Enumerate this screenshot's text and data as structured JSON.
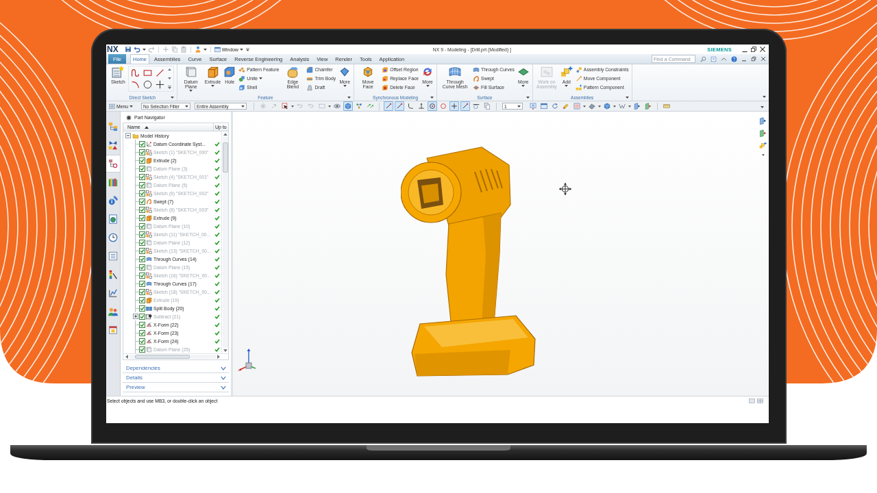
{
  "title_bar": {
    "logo": "NX",
    "window_menu": "Window",
    "title": "NX 9 - Modeling - [Drill.prt (Modified) ]",
    "brand": "SIEMENS"
  },
  "ribbon": {
    "file_menu": "File",
    "tabs": [
      {
        "label": "Home",
        "selected": true
      },
      {
        "label": "Assemblies",
        "selected": false
      },
      {
        "label": "Curve",
        "selected": false
      },
      {
        "label": "Surface",
        "selected": false
      },
      {
        "label": "Reverse Engineering",
        "selected": false
      },
      {
        "label": "Analysis",
        "selected": false
      },
      {
        "label": "View",
        "selected": false
      },
      {
        "label": "Render",
        "selected": false
      },
      {
        "label": "Tools",
        "selected": false
      },
      {
        "label": "Application",
        "selected": false
      }
    ],
    "search": {
      "placeholder": "Find a Command"
    },
    "groups": [
      {
        "label": "Direct Sketch",
        "items": [
          {
            "kind": "large",
            "label": "Sketch",
            "menu": false,
            "disabled": false
          },
          {
            "kind": "palette"
          }
        ]
      },
      {
        "label": "Feature",
        "items": [
          {
            "kind": "large",
            "label": "Datum Plane",
            "menu": true,
            "disabled": false
          },
          {
            "kind": "large",
            "label": "Extrude",
            "menu": true,
            "disabled": false
          },
          {
            "kind": "large",
            "label": "Hole",
            "menu": false,
            "disabled": false
          },
          {
            "kind": "stack",
            "entries": [
              {
                "label": "Pattern Feature",
                "menu": false
              },
              {
                "label": "Unite",
                "menu": true
              },
              {
                "label": "Shell",
                "menu": false
              }
            ]
          },
          {
            "kind": "large",
            "label": "Edge Blend",
            "menu": false,
            "disabled": false
          },
          {
            "kind": "stack",
            "entries": [
              {
                "label": "Chamfer",
                "menu": false
              },
              {
                "label": "Trim Body",
                "menu": false
              },
              {
                "label": "Draft",
                "menu": false
              }
            ]
          },
          {
            "kind": "large",
            "label": "More",
            "menu": true,
            "disabled": false
          }
        ]
      },
      {
        "label": "Synchronous Modeling",
        "items": [
          {
            "kind": "large",
            "label": "Move Face",
            "menu": false,
            "disabled": false
          },
          {
            "kind": "stack",
            "entries": [
              {
                "label": "Offset Region",
                "menu": false
              },
              {
                "label": "Replace Face",
                "menu": false
              },
              {
                "label": "Delete Face",
                "menu": false
              }
            ]
          },
          {
            "kind": "large",
            "label": "More",
            "menu": true,
            "disabled": false
          }
        ]
      },
      {
        "label": "Surface",
        "items": [
          {
            "kind": "large",
            "label": "Through Curve Mesh",
            "menu": false,
            "disabled": false
          },
          {
            "kind": "stack",
            "entries": [
              {
                "label": "Through Curves",
                "menu": false
              },
              {
                "label": "Swept",
                "menu": false
              },
              {
                "label": "Fill Surface",
                "menu": false
              }
            ]
          },
          {
            "kind": "large",
            "label": "More",
            "menu": true,
            "disabled": false
          }
        ]
      },
      {
        "label": "Assemblies",
        "items": [
          {
            "kind": "large",
            "label": "Work on Assembly",
            "menu": false,
            "disabled": true
          },
          {
            "kind": "large",
            "label": "Add",
            "menu": true,
            "disabled": false
          },
          {
            "kind": "stack",
            "entries": [
              {
                "label": "Assembly Constraints",
                "menu": false
              },
              {
                "label": "Move Component",
                "menu": false
              },
              {
                "label": "Pattern Component",
                "menu": false
              }
            ]
          }
        ]
      }
    ]
  },
  "toolbar": {
    "menu": "Menu",
    "filters": [
      "No Selection Filter",
      "Entire Assembly"
    ],
    "selection_tools": [
      {
        "selected": false
      },
      {
        "selected": false
      },
      {
        "selected": false
      },
      {
        "selected": false
      },
      {
        "selected": false
      },
      {
        "selected": false
      },
      {
        "selected": false
      },
      {
        "selected": true
      },
      {
        "selected": false
      },
      {
        "selected": false
      }
    ],
    "snap_tools": [
      {
        "selected": true
      },
      {
        "selected": true
      },
      {
        "selected": false
      },
      {
        "selected": false
      },
      {
        "selected": true
      },
      {
        "selected": false
      },
      {
        "selected": true
      },
      {
        "selected": true
      },
      {
        "selected": false
      },
      {
        "selected": false
      }
    ],
    "layer": "1",
    "view_tools": [
      {
        "selected": false
      },
      {
        "selected": false
      },
      {
        "selected": false
      },
      {
        "selected": false
      },
      {
        "selected": false
      },
      {
        "selected": false
      },
      {
        "selected": false
      },
      {
        "selected": false
      },
      {
        "selected": false
      },
      {
        "selected": false
      },
      {
        "selected": false
      }
    ]
  },
  "resource_bar": {
    "tabs": [
      {
        "selected": false
      },
      {
        "selected": false
      },
      {
        "selected": true
      },
      {
        "selected": false
      },
      {
        "selected": false
      },
      {
        "selected": false
      },
      {
        "selected": false
      },
      {
        "selected": false
      },
      {
        "selected": false
      },
      {
        "selected": false
      },
      {
        "selected": false
      },
      {
        "selected": false
      }
    ]
  },
  "part_navigator": {
    "title": "Part Navigator",
    "columns": [
      "Name",
      "Up to"
    ],
    "tree": [
      {
        "label": "Model History",
        "kind": "folder",
        "expanded": true,
        "children": [
          {
            "label": "Datum Coordinate Syst...",
            "kind": "csys",
            "checked": true,
            "dimmed": false,
            "up_to": true,
            "expandable": false
          },
          {
            "label": "Sketch (1) \"SKETCH_000\"",
            "kind": "sketch",
            "checked": true,
            "dimmed": true,
            "up_to": true,
            "expandable": false
          },
          {
            "label": "Extrude (2)",
            "kind": "extrude",
            "checked": true,
            "dimmed": false,
            "up_to": true,
            "expandable": false
          },
          {
            "label": "Datum Plane (3)",
            "kind": "plane",
            "checked": true,
            "dimmed": true,
            "up_to": true,
            "expandable": false
          },
          {
            "label": "Sketch (4) \"SKETCH_001\"",
            "kind": "sketch",
            "checked": true,
            "dimmed": true,
            "up_to": true,
            "expandable": false
          },
          {
            "label": "Datum Plane (5)",
            "kind": "plane",
            "checked": true,
            "dimmed": true,
            "up_to": true,
            "expandable": false
          },
          {
            "label": "Sketch (6) \"SKETCH_002\"",
            "kind": "sketch",
            "checked": true,
            "dimmed": true,
            "up_to": true,
            "expandable": false
          },
          {
            "label": "Swept (7)",
            "kind": "swept",
            "checked": true,
            "dimmed": false,
            "up_to": true,
            "expandable": false
          },
          {
            "label": "Sketch (8) \"SKETCH_003\"",
            "kind": "sketch",
            "checked": true,
            "dimmed": true,
            "up_to": true,
            "expandable": false
          },
          {
            "label": "Extrude (9)",
            "kind": "extrude",
            "checked": true,
            "dimmed": false,
            "up_to": true,
            "expandable": false
          },
          {
            "label": "Datum Plane (10)",
            "kind": "plane",
            "checked": true,
            "dimmed": true,
            "up_to": true,
            "expandable": false
          },
          {
            "label": "Sketch (11) \"SKETCH_00...",
            "kind": "sketch",
            "checked": true,
            "dimmed": true,
            "up_to": true,
            "expandable": false
          },
          {
            "label": "Datum Plane (12)",
            "kind": "plane",
            "checked": true,
            "dimmed": true,
            "up_to": true,
            "expandable": false
          },
          {
            "label": "Sketch (13) \"SKETCH_00...",
            "kind": "sketch",
            "checked": true,
            "dimmed": true,
            "up_to": true,
            "expandable": false
          },
          {
            "label": "Through Curves (14)",
            "kind": "through_curves",
            "checked": true,
            "dimmed": false,
            "up_to": true,
            "expandable": false
          },
          {
            "label": "Datum Plane (15)",
            "kind": "plane",
            "checked": true,
            "dimmed": true,
            "up_to": true,
            "expandable": false
          },
          {
            "label": "Sketch (16) \"SKETCH_00...",
            "kind": "sketch",
            "checked": true,
            "dimmed": true,
            "up_to": true,
            "expandable": false
          },
          {
            "label": "Through Curves (17)",
            "kind": "through_curves",
            "checked": true,
            "dimmed": false,
            "up_to": true,
            "expandable": false
          },
          {
            "label": "Sketch (18) \"SKETCH_00...",
            "kind": "sketch",
            "checked": true,
            "dimmed": true,
            "up_to": true,
            "expandable": false
          },
          {
            "label": "Extrude (19)",
            "kind": "extrude",
            "checked": true,
            "dimmed": true,
            "up_to": true,
            "expandable": false
          },
          {
            "label": "Split Body (20)",
            "kind": "split",
            "checked": true,
            "dimmed": false,
            "up_to": true,
            "expandable": false
          },
          {
            "label": "Subtract (21)",
            "kind": "subtract",
            "checked": true,
            "dimmed": true,
            "up_to": true,
            "expandable": true
          },
          {
            "label": "X-Form (22)",
            "kind": "xform",
            "checked": true,
            "dimmed": false,
            "up_to": true,
            "expandable": false
          },
          {
            "label": "X-Form (23)",
            "kind": "xform",
            "checked": true,
            "dimmed": false,
            "up_to": true,
            "expandable": false
          },
          {
            "label": "X-Form (24)",
            "kind": "xform",
            "checked": true,
            "dimmed": false,
            "up_to": true,
            "expandable": false
          },
          {
            "label": "Datum Plane (25)",
            "kind": "plane",
            "checked": true,
            "dimmed": true,
            "up_to": true,
            "expandable": false
          }
        ]
      }
    ],
    "panels": [
      "Dependencies",
      "Details",
      "Preview"
    ]
  },
  "status_bar": {
    "message": "Select objects and use MB3, or double-click an object"
  }
}
